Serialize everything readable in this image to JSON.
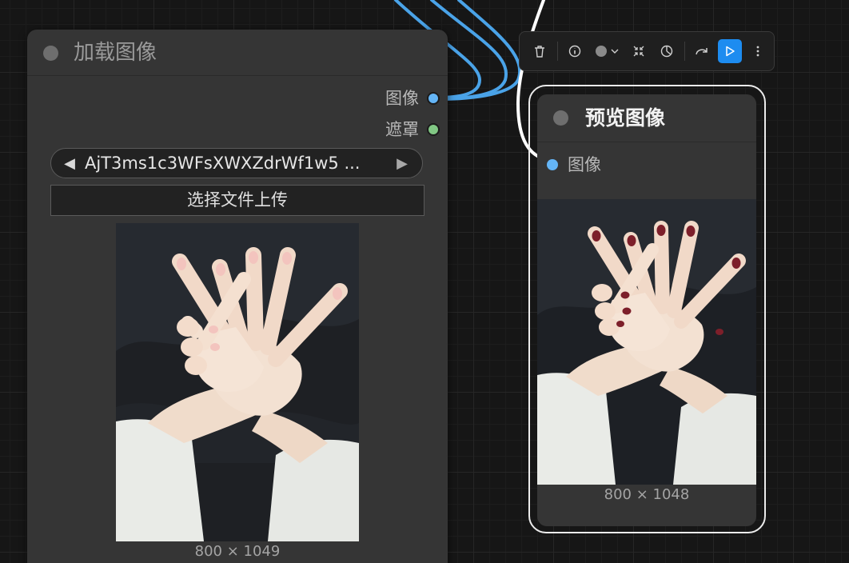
{
  "load_node": {
    "title": "加载图像",
    "outputs": [
      {
        "label": "图像",
        "color": "#64b5f6"
      },
      {
        "label": "遮罩",
        "color": "#81c784"
      }
    ],
    "image_combo": {
      "value": "AjT3ms1c3WFsXWXZdrWf1w5 ...",
      "prev_icon": "triangle-left-icon",
      "next_icon": "triangle-right-icon"
    },
    "upload_label": "选择文件上传",
    "image_size": "800 × 1049"
  },
  "toolbar": {
    "icons": [
      "trash-icon",
      "info-icon",
      "color-picker-icon",
      "collapse-icon",
      "bypass-icon",
      "redo-icon",
      "run-icon",
      "more-icon"
    ],
    "accent": "#1d8cf0"
  },
  "preview_node": {
    "title": "预览图像",
    "input": {
      "label": "图像",
      "color": "#64b5f6"
    },
    "image_size": "800 × 1048"
  },
  "colors": {
    "image_link": "#4aa3e8",
    "selected_link": "#ffffff",
    "nail_left": "#f3c4be",
    "nail_right": "#7d1f2a"
  }
}
